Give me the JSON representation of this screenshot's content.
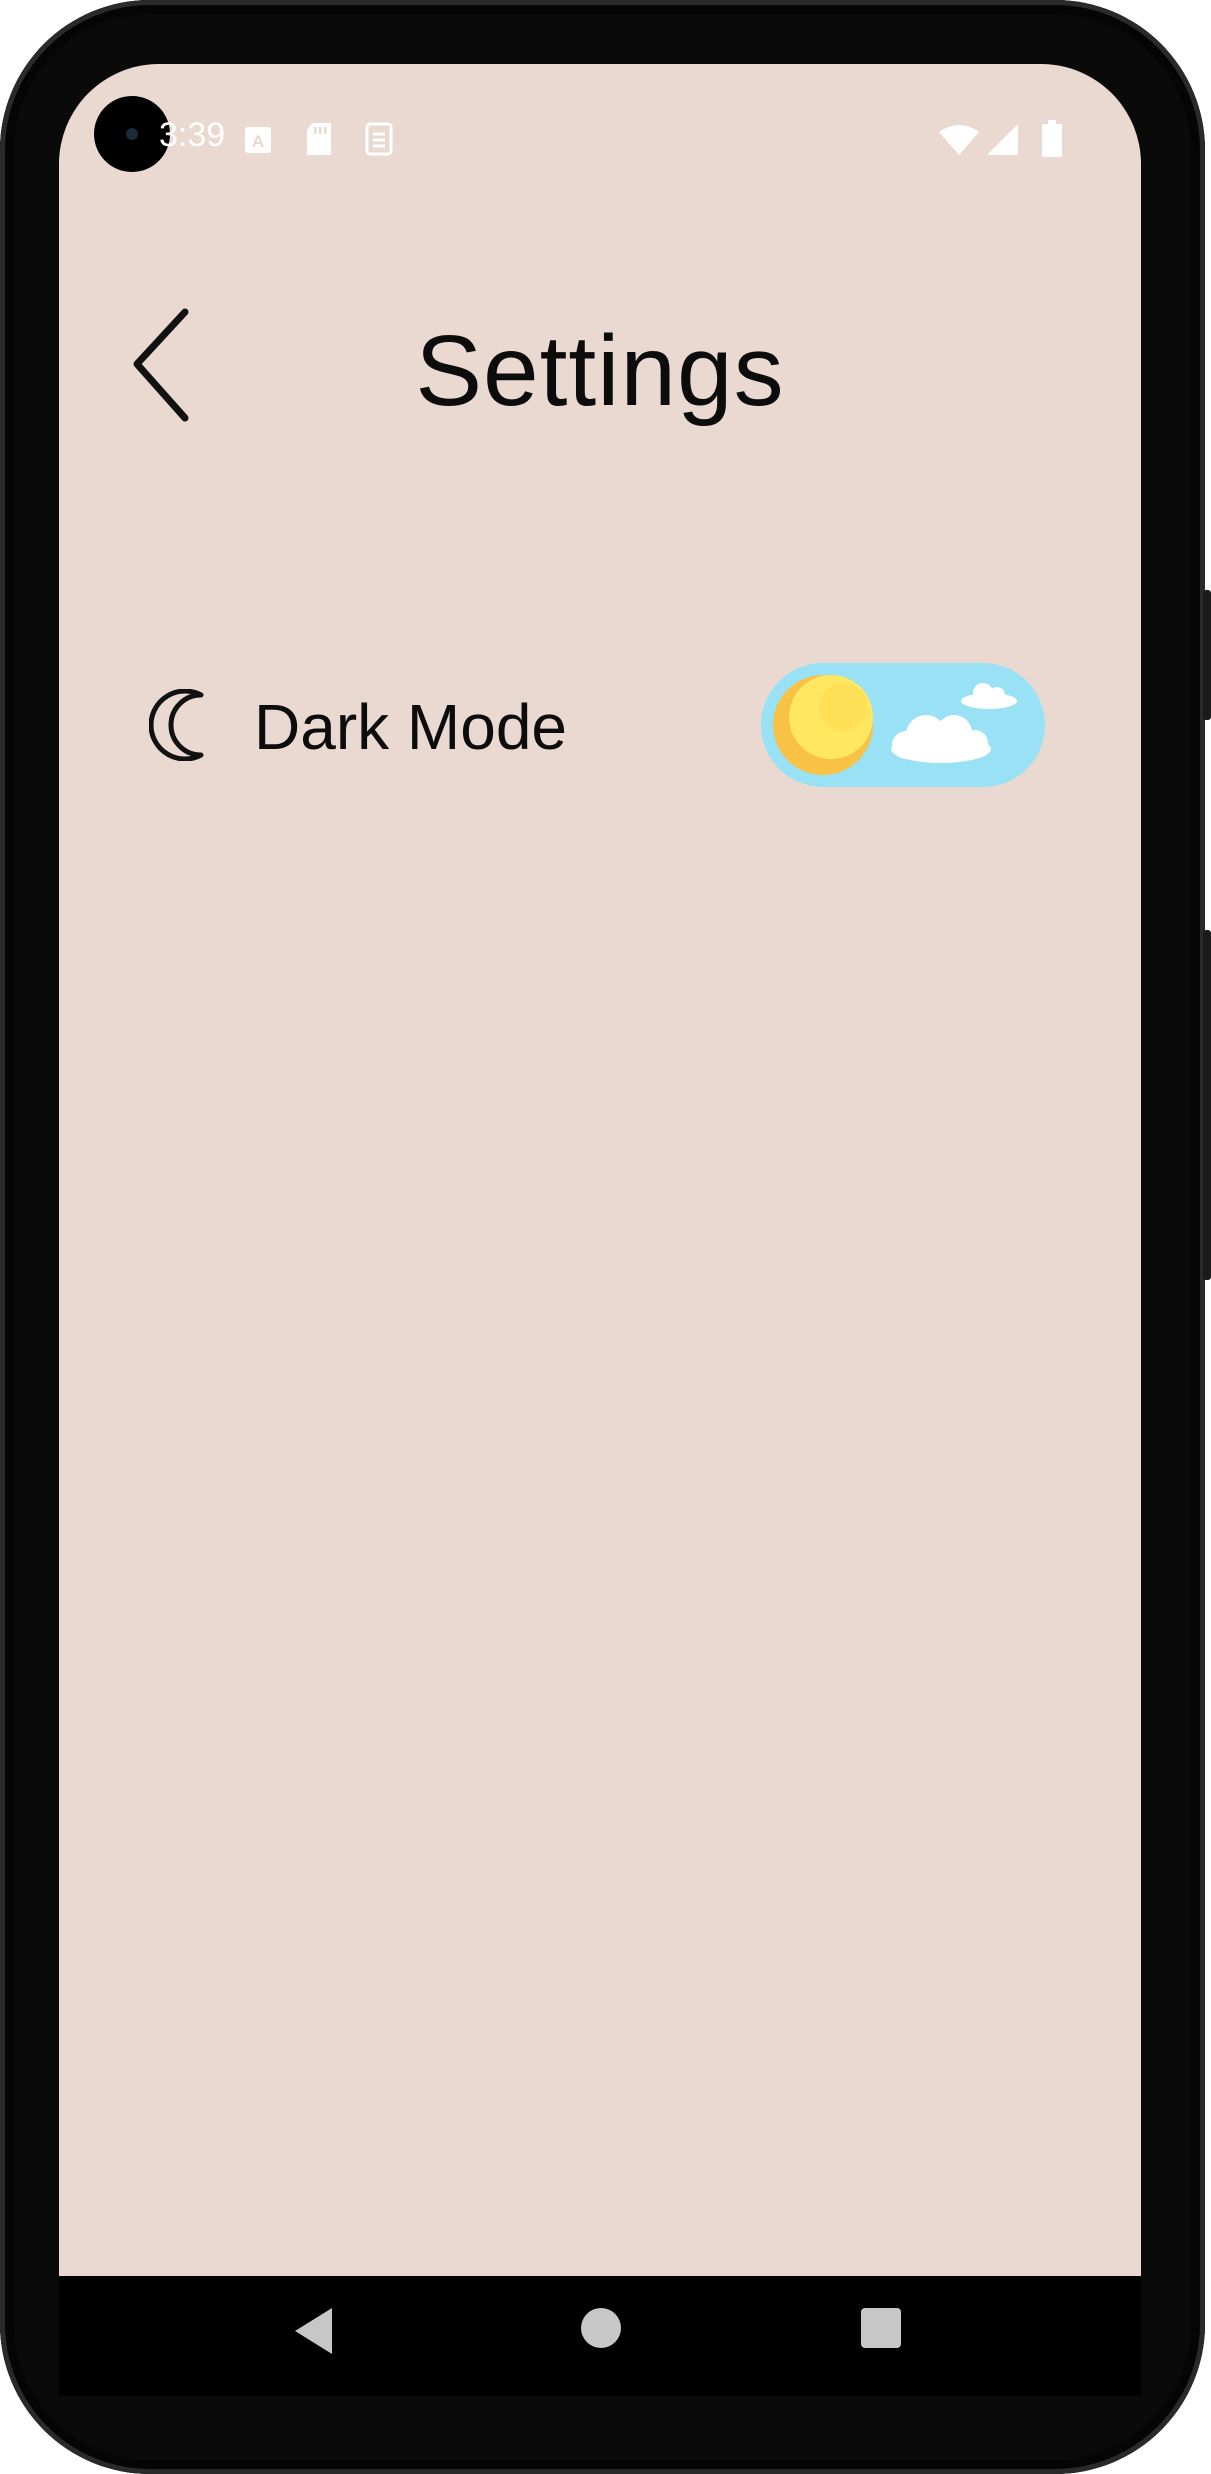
{
  "status_bar": {
    "time": "3:39",
    "icons": [
      "text-icon",
      "sd-card-icon",
      "sync-icon",
      "wifi-icon",
      "signal-icon",
      "battery-icon"
    ]
  },
  "header": {
    "title": "Settings",
    "back_icon": "chevron-left-icon"
  },
  "settings": {
    "items": [
      {
        "icon": "moon-icon",
        "label": "Dark Mode",
        "toggle": {
          "state": "off",
          "theme": "day",
          "colors": {
            "track": "#99e1f5",
            "sun": "#ffe760",
            "sun_shadow": "#f7c246",
            "cloud": "#ffffff"
          }
        }
      }
    ]
  },
  "nav_bar": {
    "buttons": [
      "back-triangle-icon",
      "home-circle-icon",
      "recents-square-icon"
    ]
  },
  "colors": {
    "background": "#e9d9d1",
    "text": "#0c0c0c",
    "device": "#0a0a0a"
  }
}
